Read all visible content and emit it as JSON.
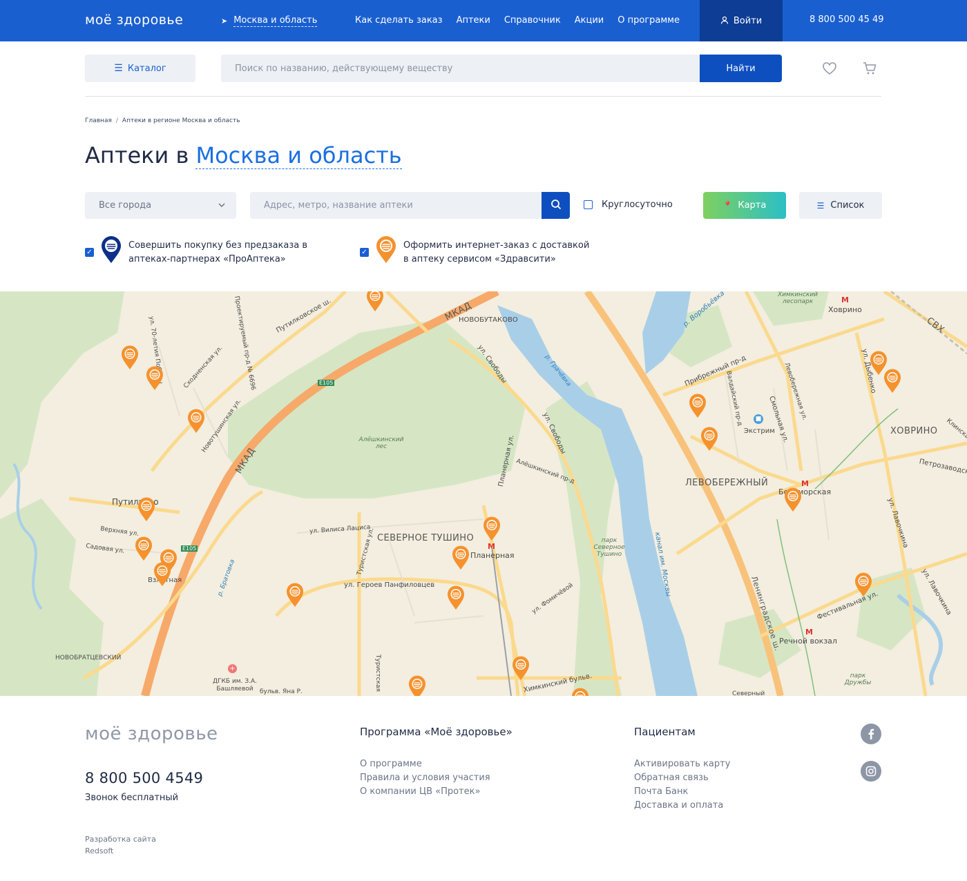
{
  "header": {
    "logo": "моё здоровье",
    "region": "Москва и область",
    "nav": [
      "Как сделать заказ",
      "Аптеки",
      "Справочник",
      "Акции",
      "О программе"
    ],
    "login": "Войти",
    "phone": "8 800 500 45 49"
  },
  "search": {
    "catalog": "Каталог",
    "placeholder": "Поиск по названию, действующему веществу",
    "button": "Найти"
  },
  "breadcrumbs": [
    "Главная",
    "Аптеки в регионе Москва и область"
  ],
  "title": {
    "prefix": "Аптеки в ",
    "region": "Москва и область"
  },
  "filters": {
    "city": "Все города",
    "address_placeholder": "Адрес, метро, название аптеки",
    "round_clock": "Круглосуточно",
    "map": "Карта",
    "list": "Список"
  },
  "legend": {
    "partner_line1": "Совершить покупку без предзаказа в",
    "partner_line2": "аптеках-партнерах «ПроАптека»",
    "zdravcity_line1": "Оформить интернет-заказ с доставкой",
    "zdravcity_line2": "в аптеку сервисом «Здравсити»"
  },
  "map": {
    "labels": {
      "mkad_top": "МКАД",
      "mkad_left": "МКАД",
      "novobutakovo": "НОВОБУТАКОВО",
      "putilkovskoe": "Путилковское ш.",
      "sv_street": "ул. Свободы",
      "sv_street2": "ул. Свободы",
      "alesh_forest": "Алёшкинский лес",
      "planernaya_st": "Планерная ул.",
      "aleshkinsky_pr": "Алёшкинский пр-д",
      "sev_tushino": "СЕВЕРНОЕ ТУШИНО",
      "vilisa": "ул. Вилиса Лациса",
      "turist": "Туристская ул.",
      "turist2": "Туристская",
      "panfilovtsev": "ул. Героев Панфиловцев",
      "planernaya_metro": "Планерная",
      "fomichevoi": "ул. Фомичёвой",
      "park_tushino": "парк Северное Тушино",
      "canal": "канал им. Москвы",
      "leningradskoe": "Ленинградское ш.",
      "levoberezhny": "ЛЕВОБЕРЕЖНЫЙ",
      "belomorskaya": "Беломорская",
      "khovrino_area": "ХОВРИНО",
      "khovrino_st": "Ховрино",
      "rechnoy": "Речной вокзал",
      "festivalnaya": "Фестивальная ул.",
      "lavochkina": "ул. Лавочкина",
      "lavochkina2": "ул. Лавочкина",
      "dybenko": "ул. Дыбенко",
      "pribrezhny": "Прибрежный пр-д",
      "smolnaya": "Смольная ул.",
      "vodnikovy": "Валдайский пр-д",
      "levoberezh_st": "Левобережная ул.",
      "ekstrim": "Экстрим",
      "putilkovo": "Путилково",
      "verkhnyaya": "Верхняя ул.",
      "sadovaya": "Садовая ул.",
      "vzletnaya": "Взлётная",
      "bratovka": "р. Братовка",
      "novobratsevsky": "НОВОБРАТЦЕВСКИЙ",
      "dgkb": "ДГКБ им. З.А. Башляевой",
      "khimkinsky": "Химкинский бульв.",
      "bulv_yana": "бульв. Яна Р.",
      "park_druzhby": "парк Дружбы",
      "skhodnenskaya": "Сходненская ул.",
      "novotushinskaya": "Новотушинская ул.",
      "ul70": "ул. 70-летия Победы",
      "vorobievka": "р. Воробьёвка",
      "grachevka": "р. Грачёвка",
      "khimki_forest": "Химкинский лесопарк",
      "svh": "СВХ",
      "petrozavod": "Петрозаводская",
      "klinsk": "Клинская",
      "severny": "Северный",
      "route": "Проектируемый пр-д № 6696",
      "e105": "E105",
      "e105b": "E105"
    }
  },
  "footer": {
    "logo": "моё здоровье",
    "phone": "8 800 500 4549",
    "phone_note": "Звонок бесплатный",
    "dev_line1": "Разработка сайта",
    "dev_line2": "Redsoft",
    "program": {
      "title": "Программа «Моё здоровье»",
      "links": [
        "О программе",
        "Правила и условия участия",
        "О компании ЦВ «Протек»"
      ]
    },
    "patients": {
      "title": "Пациентам",
      "links": [
        "Активировать карту",
        "Обратная связь",
        "Почта Банк",
        "Доставка и оплата"
      ]
    }
  },
  "colors": {
    "brand_blue": "#1a5fd0",
    "pin_orange": "#f5922e",
    "map_bg": "#f3eedf"
  }
}
